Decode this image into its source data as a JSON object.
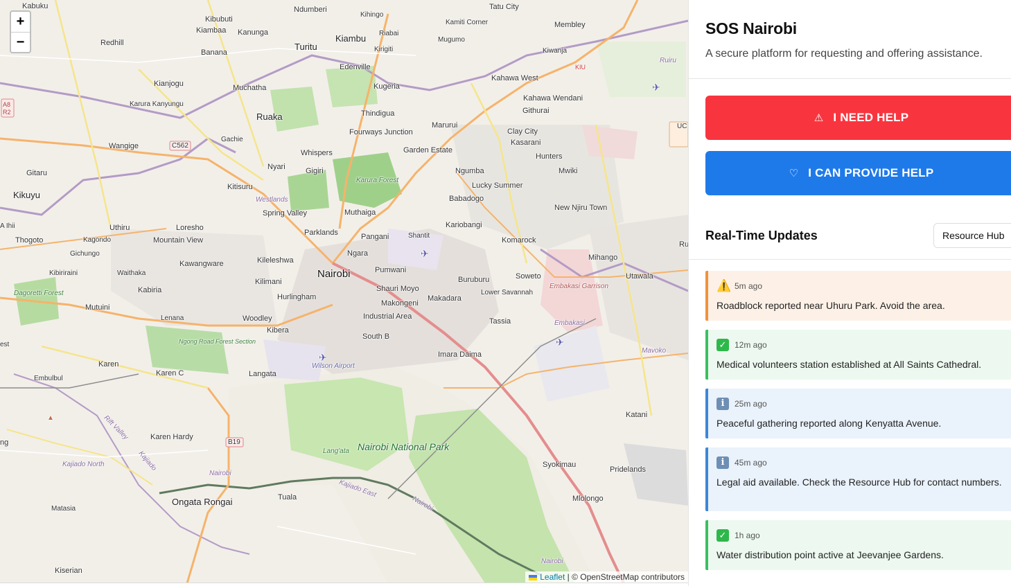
{
  "map": {
    "zoom_in": "+",
    "zoom_out": "−",
    "attribution_link": "Leaflet",
    "attribution_text": "| © OpenStreetMap contributors",
    "labels": {
      "kabuku": "Kabuku",
      "ndumberi": "Ndumberi",
      "kihingo": "Kihingo",
      "tatu_city": "Tatu City",
      "kiambu_top": "Kiambu",
      "kibubuti": "Kibubuti",
      "kiambaa": "Kiambaa",
      "kanunga": "Kanunga",
      "riabai": "Riabai",
      "kamiti_corner": "Kamiti Corner",
      "membley": "Membley",
      "redhill": "Redhill",
      "banana": "Banana",
      "turitu": "Turitu",
      "kiambu": "Kiambu",
      "mugumo": "Mugumo",
      "kirigiti": "Kirigiti",
      "kiwanja": "Kiwanja",
      "ruiru": "Ruiru",
      "edenville": "Edenville",
      "kiu": "KIU",
      "kianjogu": "Kianjogu",
      "muchatha": "Muchatha",
      "kugeria": "Kugeria",
      "kahawa_west": "Kahawa West",
      "karura_kanyungu": "Karura Kanyungu",
      "kahawa_wendani": "Kahawa Wendani",
      "githurai": "Githurai",
      "ruaka": "Ruaka",
      "thindigua": "Thindigua",
      "marurui": "Marurui",
      "fourways": "Fourways Junction",
      "clay_city": "Clay City",
      "gachie": "Gachie",
      "kasarani": "Kasarani",
      "wangige": "Wangige",
      "c562": "C562",
      "garden_estate": "Garden Estate",
      "whispers": "Whispers",
      "hunters": "Hunters",
      "nyari": "Nyari",
      "gigiri": "Gigiri",
      "ngumba": "Ngumba",
      "mwiki": "Mwiki",
      "gitaru": "Gitaru",
      "karura_forest": "Karura Forest",
      "lucky_summer": "Lucky Summer",
      "kitisuru": "Kitisuru",
      "kikuyu": "Kikuyu",
      "westlands": "Westlands",
      "babadogo": "Babadogo",
      "spring_valley": "Spring Valley",
      "muthaiga": "Muthaiga",
      "new_njiru": "New Njiru Town",
      "loresho": "Loresho",
      "kariobangi": "Kariobangi",
      "uthiru": "Uthiru",
      "parklands": "Parklands",
      "shantit": "Shantit",
      "thogoto": "Thogoto",
      "kagondo": "Kagondo",
      "mountain_view": "Mountain View",
      "pangani": "Pangani",
      "komarock": "Komarock",
      "gichungo": "Gichungo",
      "kawangware": "Kawangware",
      "kileleshwa": "Kileleshwa",
      "ngara": "Ngara",
      "mihango": "Mihango",
      "kibiriraini": "Kibiriraini",
      "waithaka": "Waithaka",
      "nairobi": "Nairobi",
      "pumwani": "Pumwani",
      "utawala": "Utawala",
      "kilimani": "Kilimani",
      "soweto": "Soweto",
      "buruburu": "Buruburu",
      "dagoretti": "Dagoretti Forest",
      "kabiria": "Kabiria",
      "shauri_moyo": "Shauri Moyo",
      "embakasi_garrison": "Embakasi Garrison",
      "hurlingham": "Hurlingham",
      "makadara": "Makadara",
      "lower_savannah": "Lower Savannah",
      "mutuini": "Mutuini",
      "makongeni": "Makongeni",
      "lenana": "Lenana",
      "woodley": "Woodley",
      "industrial_area": "Industrial Area",
      "tassia": "Tassia",
      "embakasi": "Embakasi",
      "kibera": "Kibera",
      "ngong_forest": "Ngong Road Forest Section",
      "south_b": "South B",
      "mavoko": "Mavoko",
      "karen": "Karen",
      "wilson": "Wilson Airport",
      "imara_daima": "Imara Daima",
      "embulbul": "Embulbul",
      "karen_c": "Karen C",
      "langata": "Langata",
      "katani": "Katani",
      "karen_hardy": "Karen Hardy",
      "b19": "B19",
      "langata_low": "Lang'ata",
      "nairobi_np": "Nairobi National Park",
      "syokimau": "Syokimau",
      "kajiado_north": "Kajiado North",
      "pridelands": "Pridelands",
      "ongata_rongai": "Ongata Rongai",
      "tuala": "Tuala",
      "kajiado_east": "Kajiado East",
      "mlolongo": "Mlolongo",
      "matasia": "Matasia",
      "kiserian": "Kiserian",
      "ng": "ng",
      "est": "est",
      "a_ihii": "A Ihii",
      "ru": "Ru",
      "uc": "UC",
      "a8": "A8",
      "r2": "R2",
      "nairobi_road": "Nairobi",
      "nairobi_road2": "Nairobi",
      "nairobi_road3": "Nairobi",
      "kajiado_road": "Kajiado",
      "rift_valley": "Rift Valley",
      "ruiru_road": "Ruiru"
    }
  },
  "header": {
    "title": "SOS Nairobi",
    "subtitle": "A secure platform for requesting and offering assistance."
  },
  "actions": {
    "need_help": "I NEED HELP",
    "need_help_icon": "⚠",
    "provide_help": "I CAN PROVIDE HELP",
    "provide_help_icon": "♡"
  },
  "updates": {
    "title": "Real-Time Updates",
    "hub_button": "Resource Hub",
    "items": [
      {
        "type": "warn",
        "icon": "⚠️",
        "time": "5m ago",
        "text": "Roadblock reported near Uhuru Park. Avoid the area."
      },
      {
        "type": "ok",
        "icon": "✓",
        "time": "12m ago",
        "text": "Medical volunteers station established at All Saints Cathedral."
      },
      {
        "type": "info",
        "icon": "i",
        "time": "25m ago",
        "text": "Peaceful gathering reported along Kenyatta Avenue."
      },
      {
        "type": "info",
        "icon": "i",
        "time": "45m ago",
        "text": "Legal aid available. Check the Resource Hub for contact numbers."
      },
      {
        "type": "ok",
        "icon": "✓",
        "time": "1h ago",
        "text": "Water distribution point active at Jeevanjee Gardens."
      }
    ]
  },
  "colors": {
    "danger": "#f8353f",
    "primary": "#1f7ae9",
    "warn_border": "#f3913c",
    "ok_border": "#3ac060",
    "info_border": "#3c87d8"
  }
}
